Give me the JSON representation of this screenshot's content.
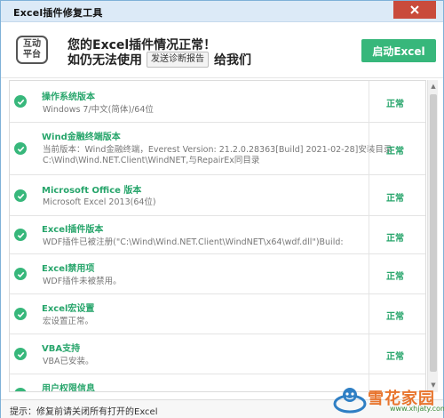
{
  "window": {
    "title": "Excel插件修复工具"
  },
  "header": {
    "logo_line1": "互动",
    "logo_line2": "平台",
    "headline": "您的Excel插件情况正常！",
    "subline_prefix": "如仍无法使用",
    "report_button": "发送诊断报告",
    "subline_suffix": "给我们",
    "start_button": "启动Excel"
  },
  "items": [
    {
      "name": "操作系统版本",
      "detail": [
        "Windows 7/中文(简体)/64位"
      ],
      "status": "正常"
    },
    {
      "name": "Wind金融终端版本",
      "detail": [
        "当前版本：Wind金融终端，Everest Version:  21.2.0.28363[Build]  2021-02-28]安装目录",
        "C:\\Wind\\Wind.NET.Client\\WindNET,与RepairEx同目录"
      ],
      "status": "正常"
    },
    {
      "name": "Microsoft Office 版本",
      "detail": [
        "Microsoft Excel 2013(64位)"
      ],
      "status": "正常"
    },
    {
      "name": "Excel插件版本",
      "detail": [
        "WDF插件已被注册(\"C:\\Wind\\Wind.NET.Client\\WindNET\\x64\\wdf.dll\")Build:"
      ],
      "status": "正常"
    },
    {
      "name": "Excel禁用项",
      "detail": [
        "WDF插件未被禁用。"
      ],
      "status": "正常"
    },
    {
      "name": "Excel宏设置",
      "detail": [
        "宏设置正常。"
      ],
      "status": "正常"
    },
    {
      "name": "VBA支持",
      "detail": [
        "VBA已安装。"
      ],
      "status": "正常"
    },
    {
      "name": "用户权限信息",
      "detail": [],
      "status": ""
    }
  ],
  "statusbar": {
    "tip": "提示：修复前请关闭所有打开的Excel"
  },
  "watermark": {
    "title": "雪花家园",
    "url": "www.xhjaty.com"
  },
  "colors": {
    "accent": "#37b77b",
    "accent_text": "#27a56b",
    "titlebar": "#dceaf7",
    "close": "#c94b3b"
  },
  "icons": {
    "check": "check-circle-icon",
    "close": "close-icon",
    "minimize": "minimize-icon",
    "maximize": "maximize-icon"
  }
}
